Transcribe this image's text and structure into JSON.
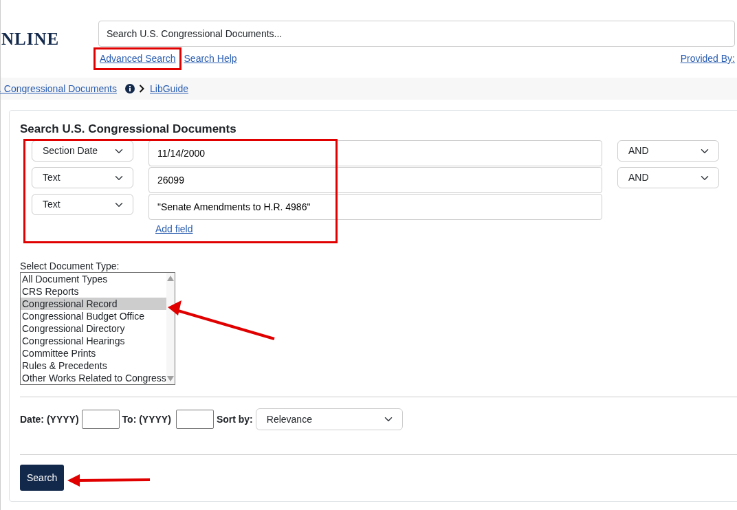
{
  "header": {
    "logo": "NLINE",
    "search": {
      "placeholder": "Search U.S. Congressional Documents..."
    },
    "links": [
      "Advanced Search",
      "Search Help"
    ],
    "provider_link": "Provided By:"
  },
  "breadcrumb": {
    "items": [
      ". Congressional Documents",
      "LibGuide"
    ]
  },
  "form": {
    "title": "Search U.S. Congressional Documents",
    "rows": [
      {
        "field": "Section Date",
        "value": "11/14/2000",
        "operator": "AND"
      },
      {
        "field": "Text",
        "value": "26099",
        "operator": "AND"
      },
      {
        "field": "Text",
        "value": "\"Senate Amendments to H.R. 4986\""
      }
    ],
    "add_field": "Add field",
    "doc_type_label": "Select Document Type:",
    "doc_types": [
      {
        "label": "All Document Types",
        "selected": false
      },
      {
        "label": "CRS Reports",
        "selected": false
      },
      {
        "label": "Congressional Record",
        "selected": true
      },
      {
        "label": "Congressional Budget Office",
        "selected": false
      },
      {
        "label": "Congressional Directory",
        "selected": false
      },
      {
        "label": "Congressional Hearings",
        "selected": false
      },
      {
        "label": "Committee Prints",
        "selected": false
      },
      {
        "label": "Rules & Precedents",
        "selected": false
      },
      {
        "label": "Other Works Related to Congress",
        "selected": false
      }
    ],
    "date_label": "Date: (YYYY)",
    "to_label": "To: (YYYY)",
    "sort_label": "Sort by:",
    "sort_value": "Relevance",
    "submit": "Search"
  }
}
